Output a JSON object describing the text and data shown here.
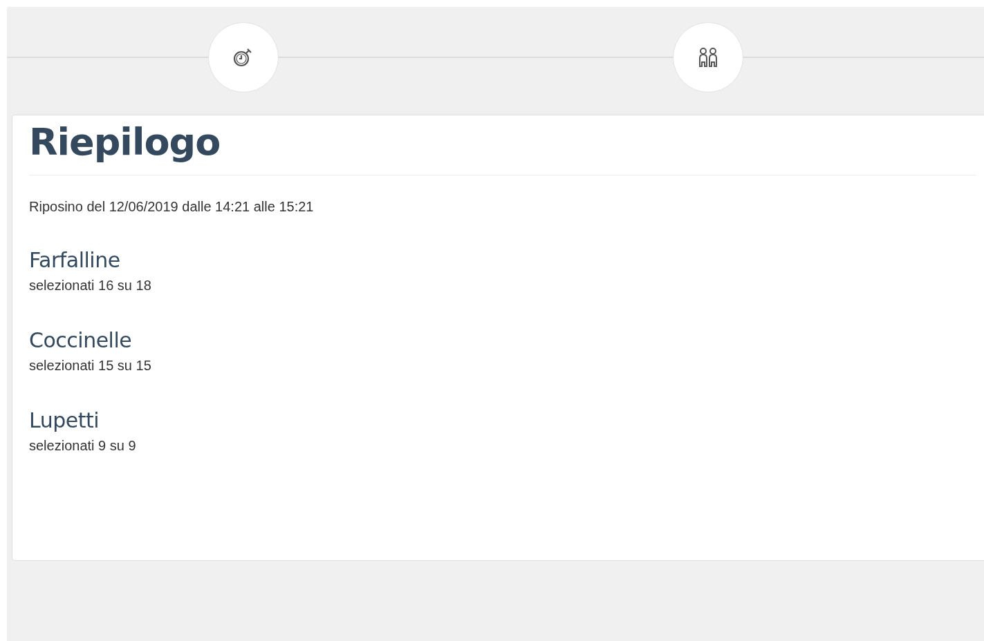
{
  "steps": [
    {
      "kind": "timer"
    },
    {
      "kind": "people"
    }
  ],
  "summary": {
    "title": "Riepilogo",
    "subtitle": "Riposino del 12/06/2019 dalle 14:21 alle 15:21",
    "groups": [
      {
        "name": "Farfalline",
        "count": "selezionati 16 su 18"
      },
      {
        "name": "Coccinelle",
        "count": "selezionati 15 su 15"
      },
      {
        "name": "Lupetti",
        "count": "selezionati 9 su 9"
      }
    ]
  }
}
